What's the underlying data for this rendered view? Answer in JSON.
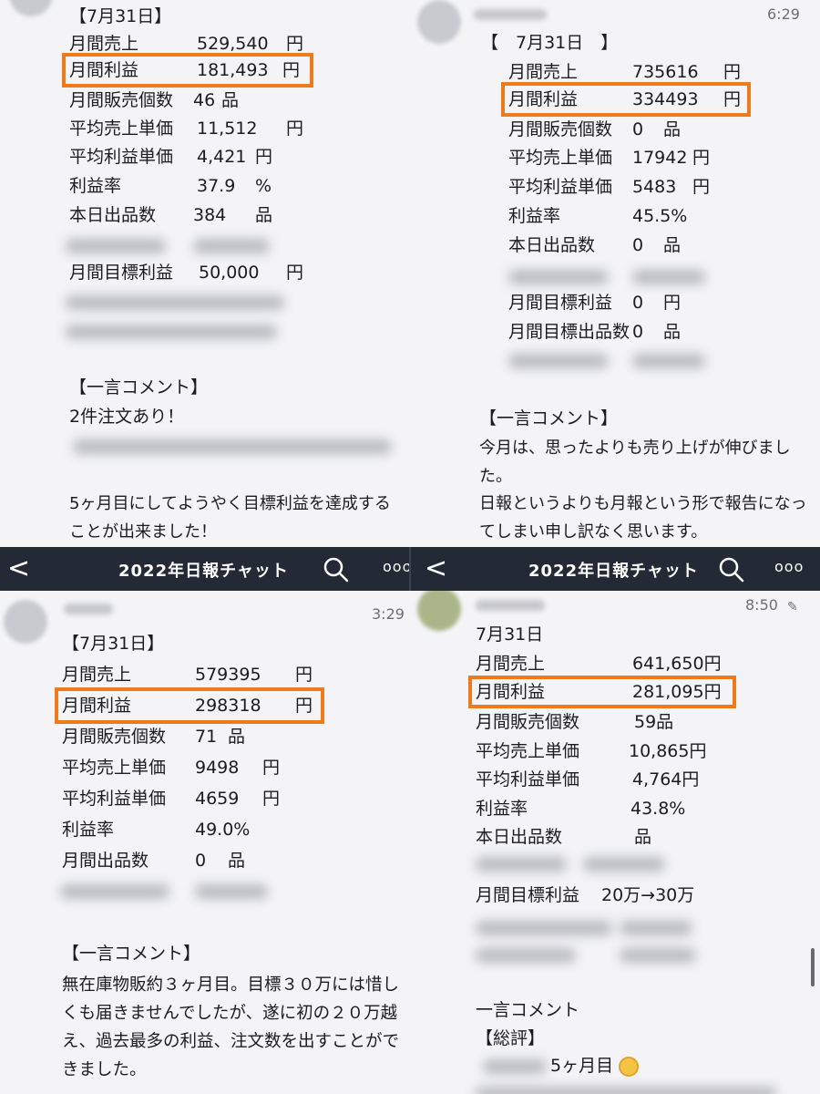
{
  "app": {
    "chat_title": "2022年日報チャット",
    "back_glyph": "<",
    "more_glyph": "ooo",
    "accent_color": "#ef7a1c",
    "navbar_color": "#232a36"
  },
  "tl": {
    "date": "【7月31日】",
    "rows": [
      {
        "label": "月間売上",
        "value": "529,540",
        "unit": "円"
      },
      {
        "label": "月間利益",
        "value": "181,493",
        "unit": "円"
      },
      {
        "label": "月間販売個数",
        "value": "46",
        "unit": "品"
      },
      {
        "label": "平均売上単価",
        "value": "11,512",
        "unit": "円"
      },
      {
        "label": "平均利益単価",
        "value": "4,421",
        "unit": "円"
      },
      {
        "label": "利益率",
        "value": "37.9",
        "unit": "%"
      },
      {
        "label": "本日出品数",
        "value": "384",
        "unit": "品"
      },
      {
        "label": "月間目標利益",
        "value": "50,000",
        "unit": "円"
      }
    ],
    "comment_header": "【一言コメント】",
    "comment_1": "2件注文あり！",
    "comment_2": "5ヶ月目にしてようやく目標利益を達成することが出来ました！"
  },
  "tr": {
    "time": "6:29",
    "date": "【　7月31日　】",
    "rows": [
      {
        "label": "月間売上",
        "value": "735616",
        "unit": "円"
      },
      {
        "label": "月間利益",
        "value": "334493",
        "unit": "円"
      },
      {
        "label": "月間販売個数",
        "value": "0",
        "unit": "品"
      },
      {
        "label": "平均売上単価",
        "value": "17942",
        "unit": "円"
      },
      {
        "label": "平均利益単価",
        "value": "5483",
        "unit": "円"
      },
      {
        "label": "利益率",
        "value": "45.5%",
        "unit": ""
      },
      {
        "label": "本日出品数",
        "value": "0",
        "unit": "品"
      },
      {
        "label": "月間目標利益",
        "value": "0",
        "unit": "円"
      },
      {
        "label": "月間目標出品数",
        "value": "0",
        "unit": "品"
      }
    ],
    "comment_header": "【一言コメント】",
    "comment_1": "今月は、思ったよりも売り上げが伸びました。",
    "comment_2": "日報というよりも月報という形で報告になってしまい申し訳なく思います。"
  },
  "bl": {
    "time": "3:29",
    "date": "【7月31日】",
    "rows": [
      {
        "label": "月間売上",
        "value": "579395",
        "unit": "円"
      },
      {
        "label": "月間利益",
        "value": "298318",
        "unit": "円"
      },
      {
        "label": "月間販売個数",
        "value": "71",
        "unit": "品"
      },
      {
        "label": "平均売上単価",
        "value": "9498",
        "unit": "円"
      },
      {
        "label": "平均利益単価",
        "value": "4659",
        "unit": "円"
      },
      {
        "label": "利益率",
        "value": "49.0%",
        "unit": ""
      },
      {
        "label": "月間出品数",
        "value": "0",
        "unit": "品"
      }
    ],
    "comment_header": "【一言コメント】",
    "comment_1": "無在庫物販約３ヶ月目。目標３０万には惜しくも届きませんでしたが、遂に初の２０万越え、過去最多の利益、注文数を出すことができました。"
  },
  "br": {
    "time": "8:50",
    "date": "7月31日",
    "rows": [
      {
        "label": "月間売上",
        "value": "641,650円"
      },
      {
        "label": "月間利益",
        "value": "281,095円"
      },
      {
        "label": "月間販売個数",
        "value": "59品"
      },
      {
        "label": "平均売上単価",
        "value": "10,865円"
      },
      {
        "label": "平均利益単価",
        "value": "4,764円"
      },
      {
        "label": "利益率",
        "value": "43.8%"
      },
      {
        "label": "本日出品数",
        "value": "品"
      },
      {
        "label": "月間目標利益",
        "value": "20万→30万"
      }
    ],
    "comment_header": "一言コメント",
    "review_header": "【総評】",
    "review_1": "5ヶ月目"
  }
}
